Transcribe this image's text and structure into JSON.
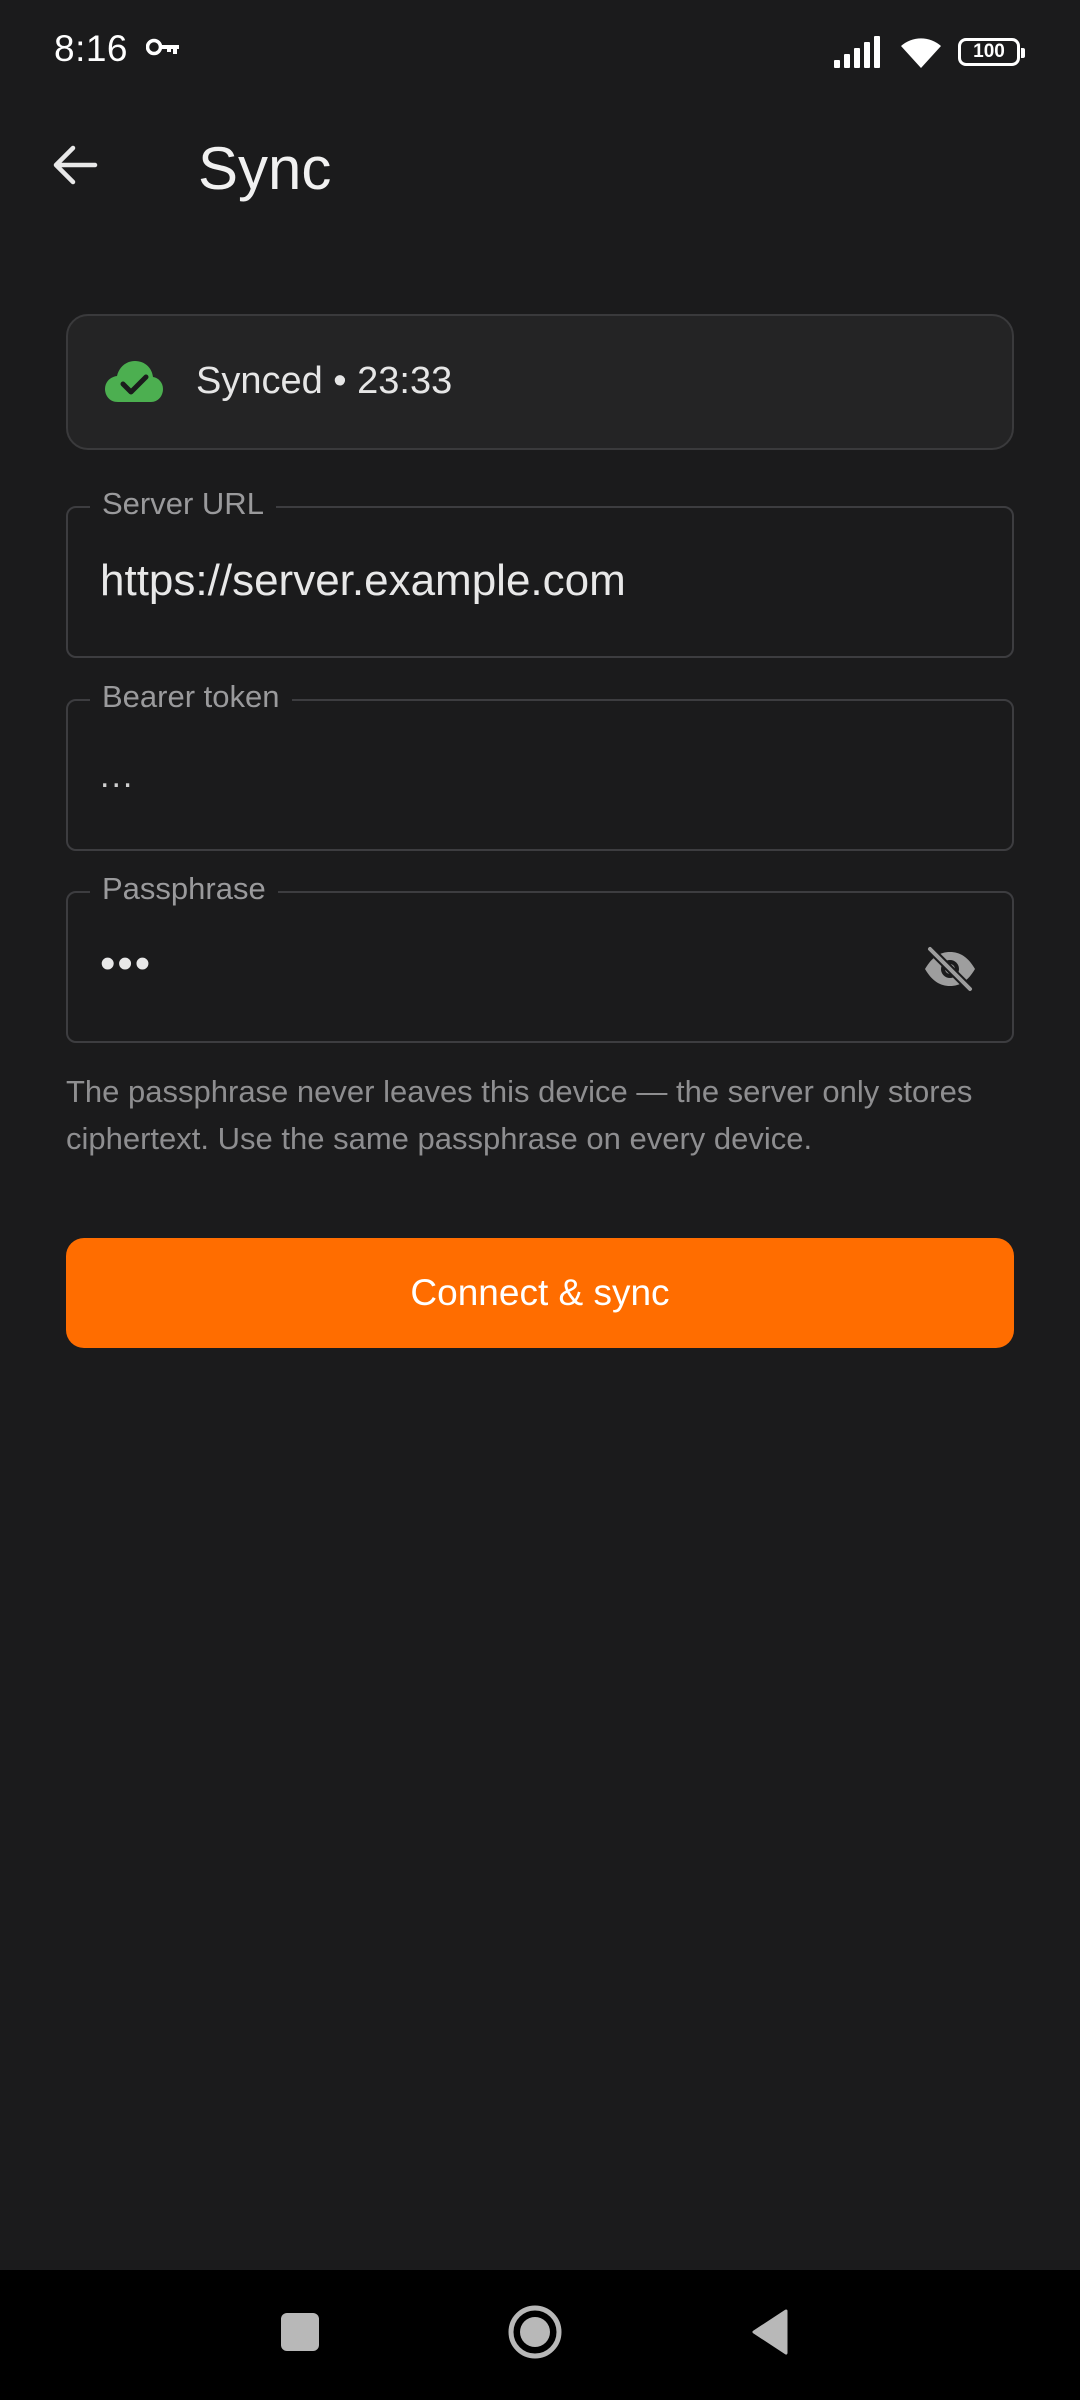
{
  "status_bar": {
    "time": "8:16",
    "battery": "100",
    "icons": [
      "key-icon",
      "signal-icon",
      "wifi-icon",
      "battery-icon"
    ]
  },
  "app_bar": {
    "title": "Sync",
    "back_icon": "arrow-back-icon"
  },
  "sync_status": {
    "text": "Synced • 23:33",
    "icon": "cloud-done-icon",
    "icon_color": "#4caf50"
  },
  "fields": {
    "server_url": {
      "label": "Server URL",
      "value": "https://server.example.com"
    },
    "bearer_token": {
      "label": "Bearer token",
      "value": "..."
    },
    "passphrase": {
      "label": "Passphrase",
      "value": "•••",
      "toggle_icon": "visibility-off-icon"
    }
  },
  "helper_text": "The passphrase never leaves this device — the server only stores ciphertext. Use the same passphrase on every device.",
  "primary_button": {
    "label": "Connect & sync",
    "color": "#ff6d00"
  },
  "nav_bar": {
    "icons": [
      "recents-icon",
      "home-icon",
      "back-triangle-icon"
    ]
  }
}
